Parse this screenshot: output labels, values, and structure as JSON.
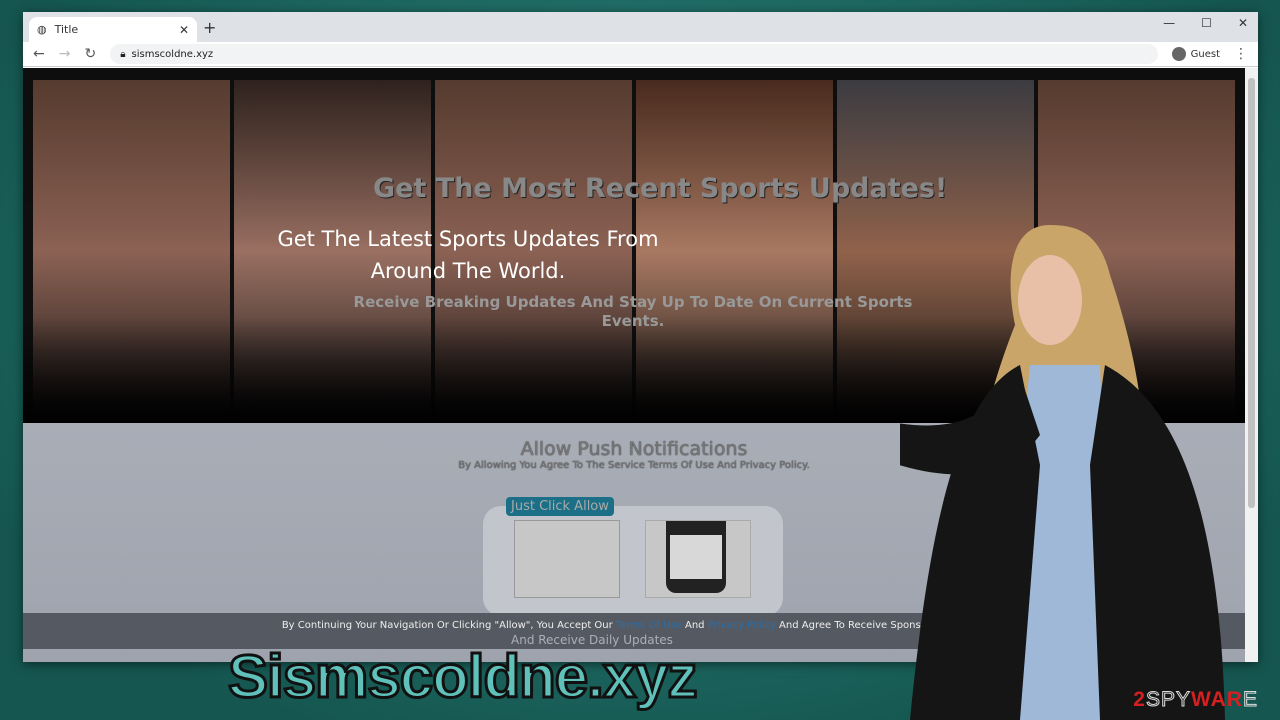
{
  "browser": {
    "tab_title": "Title",
    "url": "sismscoldne.xyz",
    "profile": "Guest"
  },
  "page": {
    "headline": "Get The Most Recent Sports Updates!",
    "subheadline": "Get The Latest Sports Updates From Around The World.",
    "tagline": "Receive Breaking Updates And Stay Up To Date On Current Sports Events.",
    "allow_title": "Allow Push Notifications",
    "allow_sub": "By Allowing You Agree To The Service Terms Of Use And Privacy Policy.",
    "just_click": "Just Click Allow",
    "daily": "And Receive Daily Updates",
    "cookie": {
      "pre": "By Continuing Your Navigation Or Clicking \"Allow\", You Accept Our ",
      "terms": "Terms Of Use",
      "mid": " And ",
      "privacy": "Privacy Policy",
      "post": " And Agree To Receive Sponsored Content"
    }
  },
  "overlay": {
    "site_name": "Sismscoldne.xyz",
    "logo": "2SPYWARE"
  },
  "colors": {
    "background": "#1f6e67",
    "brand_text": "#5fc1ba",
    "logo_red": "#d42020"
  }
}
